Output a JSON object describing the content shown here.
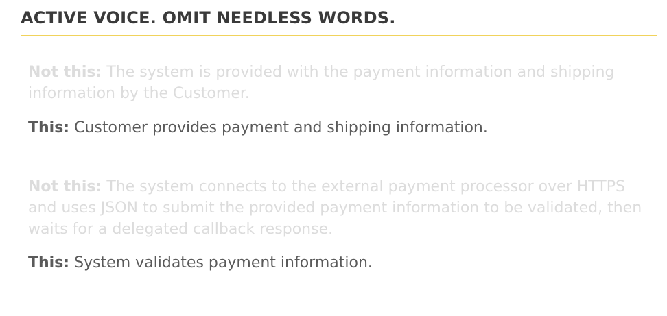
{
  "slide": {
    "title": "ACTIVE VOICE. OMIT NEEDLESS WORDS.",
    "accent_color": "#f1d35c",
    "examples": [
      {
        "not_label": "Not this:",
        "not_text": " The system is provided with the payment information and shipping information by the Customer.",
        "this_label": "This:",
        "this_text": " Customer provides payment and shipping information."
      },
      {
        "not_label": "Not this:",
        "not_text": " The system connects to the external payment processor over HTTPS and uses JSON to submit the provided payment information to be validated, then waits for a delegated callback response.",
        "this_label": "This:",
        "this_text": " System validates payment information."
      }
    ]
  }
}
